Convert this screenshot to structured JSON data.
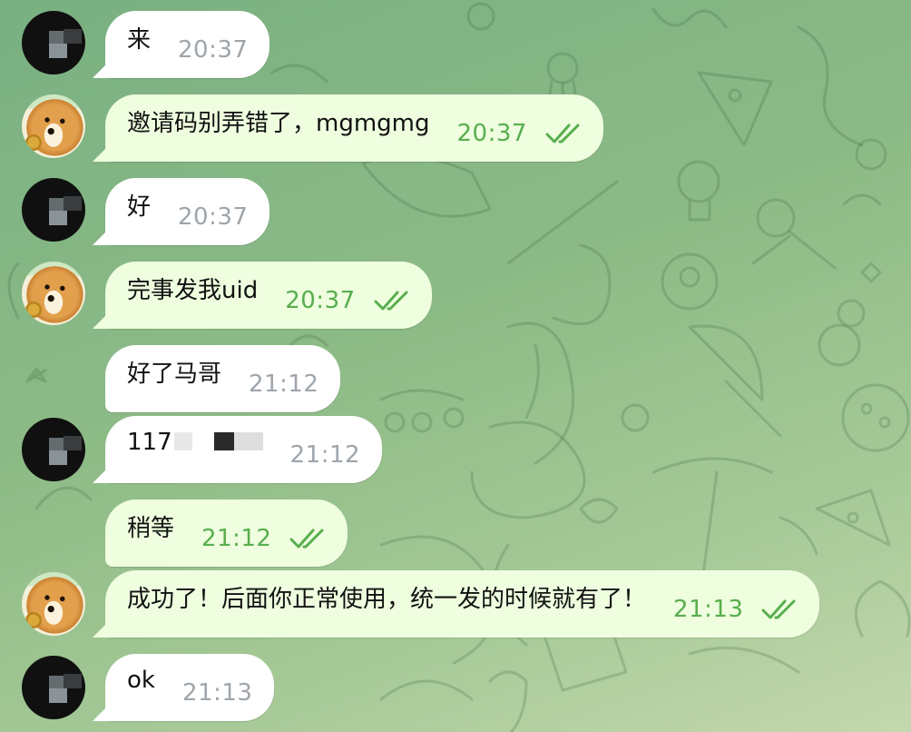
{
  "chat": {
    "messages": [
      {
        "dir": "in",
        "avatar": "pixelated-avatar",
        "text": "来",
        "time": "20:37"
      },
      {
        "dir": "out",
        "avatar": "doge-avatar",
        "text": "邀请码别弄错了，mgmgmg",
        "time": "20:37",
        "status": "read"
      },
      {
        "dir": "in",
        "avatar": "pixelated-avatar",
        "text": "好",
        "time": "20:37"
      },
      {
        "dir": "out",
        "avatar": "doge-avatar",
        "text": "完事发我uid",
        "time": "20:37",
        "status": "read"
      },
      {
        "dir": "in",
        "avatar": "",
        "text": "好了马哥",
        "time": "21:12"
      },
      {
        "dir": "in",
        "avatar": "pixelated-avatar",
        "text": "117",
        "time": "21:12",
        "redacted": true
      },
      {
        "dir": "out",
        "avatar": "",
        "text": "稍等",
        "time": "21:12",
        "status": "read"
      },
      {
        "dir": "out",
        "avatar": "doge-avatar",
        "text": "成功了！后面你正常使用，统一发的时候就有了！",
        "time": "21:13",
        "status": "read"
      },
      {
        "dir": "in",
        "avatar": "pixelated-avatar",
        "text": "ok",
        "time": "21:13"
      }
    ]
  },
  "colors": {
    "background": "#8dbb86",
    "incoming_bubble": "#ffffff",
    "outgoing_bubble": "#eefedf",
    "outgoing_time": "#58ae4e",
    "incoming_time": "#9ea5ab"
  },
  "icons": {
    "read_receipt": "double-check-icon"
  }
}
